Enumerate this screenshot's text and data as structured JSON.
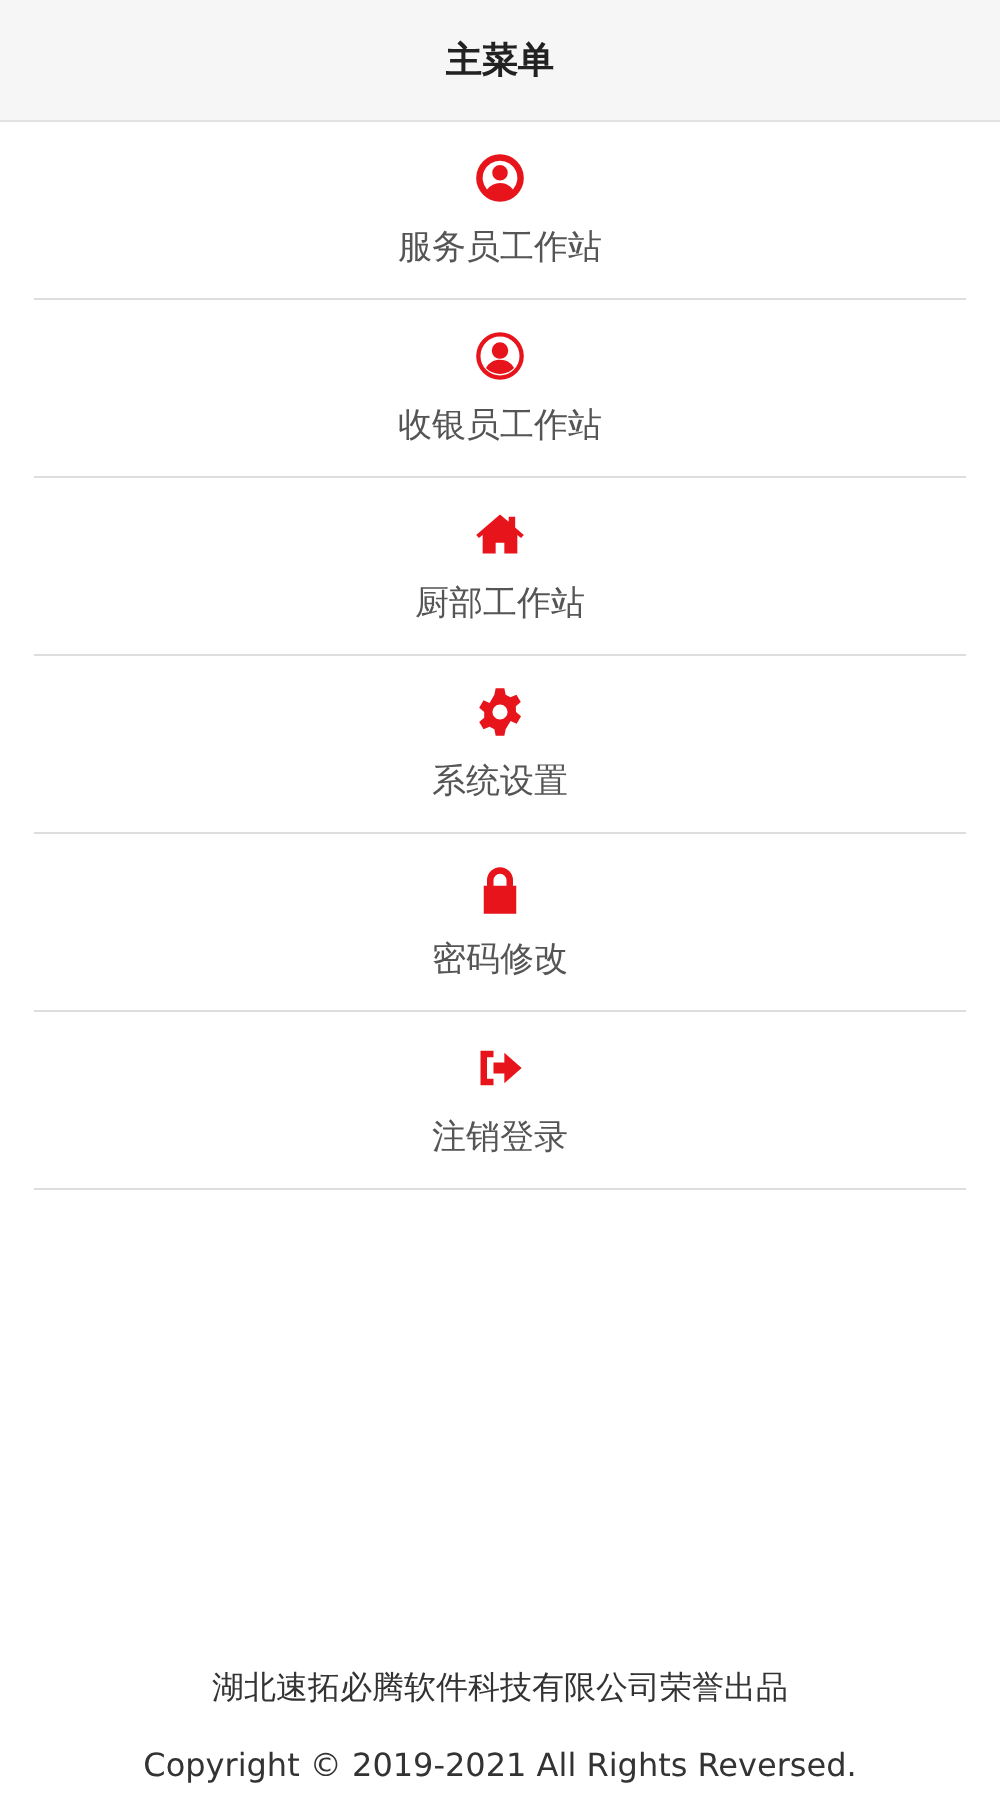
{
  "header": {
    "title": "主菜单"
  },
  "menu": [
    {
      "kind": "user",
      "label": "服务员工作站"
    },
    {
      "kind": "user-filled",
      "label": "收银员工作站"
    },
    {
      "kind": "home",
      "label": "厨部工作站"
    },
    {
      "kind": "gear",
      "label": "系统设置"
    },
    {
      "kind": "lock",
      "label": "密码修改"
    },
    {
      "kind": "sign-out",
      "label": "注销登录"
    }
  ],
  "footer": {
    "company": "湖北速拓必腾软件科技有限公司荣誉出品",
    "copyright": "Copyright © 2019-2021 All Rights Reversed."
  }
}
